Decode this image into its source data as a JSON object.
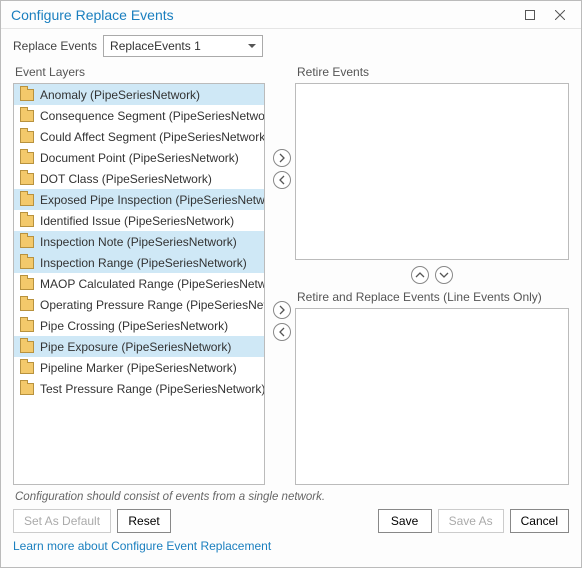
{
  "window": {
    "title": "Configure Replace Events"
  },
  "replaceEvents": {
    "label": "Replace Events",
    "value": "ReplaceEvents 1"
  },
  "panels": {
    "eventLayersLabel": "Event Layers",
    "retireLabel": "Retire Events",
    "replaceLabel": "Retire and Replace Events (Line Events Only)"
  },
  "eventLayers": [
    {
      "label": "Anomaly (PipeSeriesNetwork)",
      "selected": true
    },
    {
      "label": "Consequence Segment (PipeSeriesNetwork)",
      "selected": false
    },
    {
      "label": "Could Affect Segment (PipeSeriesNetwork)",
      "selected": false
    },
    {
      "label": "Document Point (PipeSeriesNetwork)",
      "selected": false
    },
    {
      "label": "DOT Class (PipeSeriesNetwork)",
      "selected": false
    },
    {
      "label": "Exposed Pipe Inspection (PipeSeriesNetwork)",
      "selected": true
    },
    {
      "label": "Identified Issue (PipeSeriesNetwork)",
      "selected": false
    },
    {
      "label": "Inspection Note (PipeSeriesNetwork)",
      "selected": true
    },
    {
      "label": "Inspection Range (PipeSeriesNetwork)",
      "selected": true
    },
    {
      "label": "MAOP Calculated Range (PipeSeriesNetwork)",
      "selected": false
    },
    {
      "label": "Operating Pressure Range (PipeSeriesNetwork)",
      "selected": false
    },
    {
      "label": "Pipe Crossing (PipeSeriesNetwork)",
      "selected": false
    },
    {
      "label": "Pipe Exposure (PipeSeriesNetwork)",
      "selected": true
    },
    {
      "label": "Pipeline Marker (PipeSeriesNetwork)",
      "selected": false
    },
    {
      "label": "Test Pressure Range (PipeSeriesNetwork)",
      "selected": false
    }
  ],
  "hint": "Configuration should consist of events from a single network.",
  "buttons": {
    "setAsDefault": "Set As Default",
    "reset": "Reset",
    "save": "Save",
    "saveAs": "Save As",
    "cancel": "Cancel"
  },
  "link": "Learn more about Configure Event Replacement"
}
